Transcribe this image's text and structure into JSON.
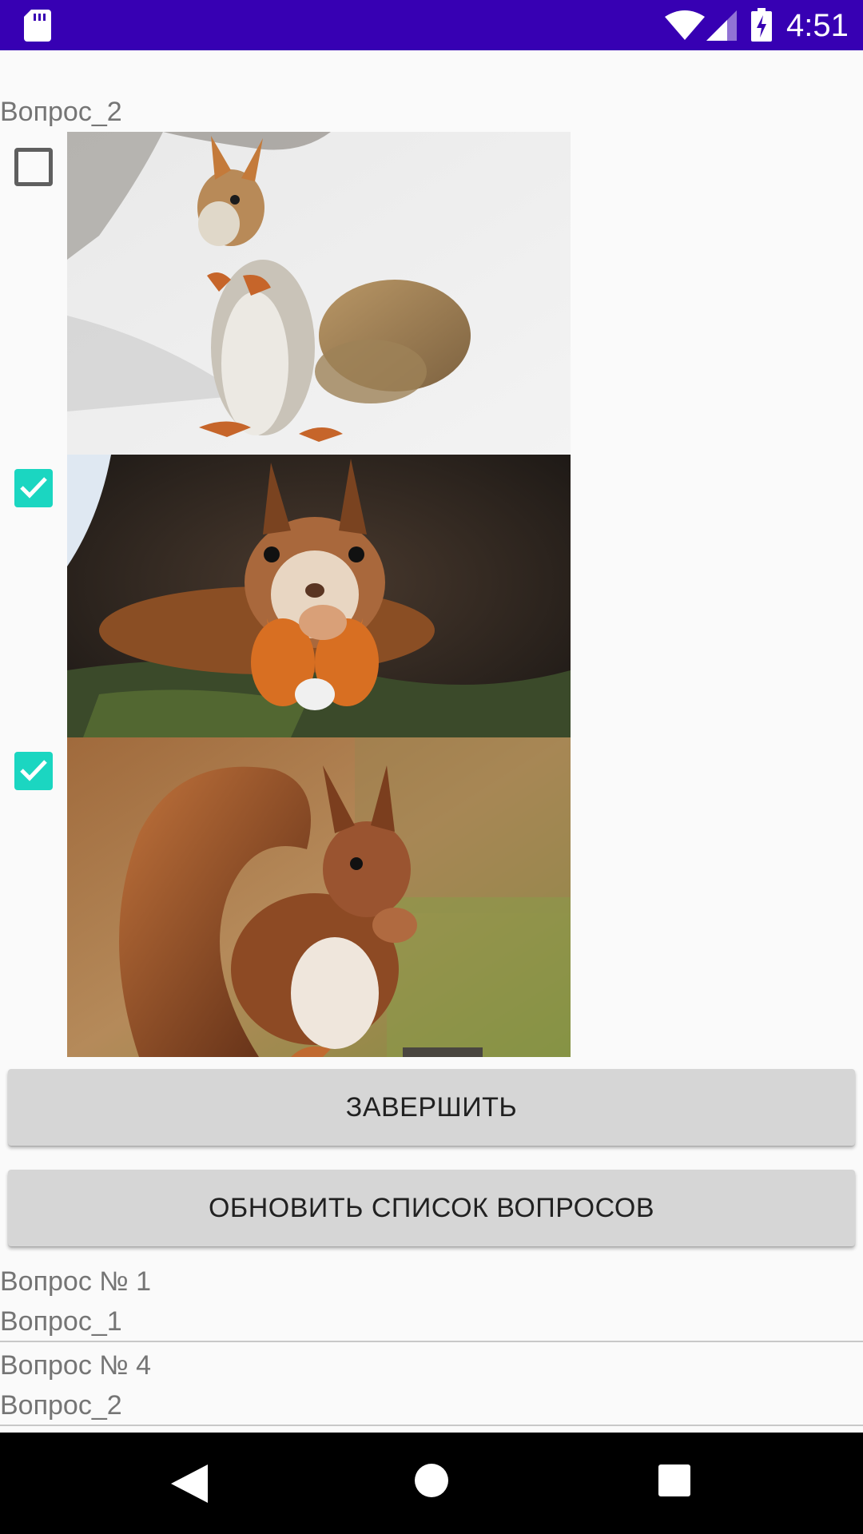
{
  "status_bar": {
    "time": "4:51",
    "icons": [
      "sd-card-icon",
      "wifi-icon",
      "cell-signal-icon",
      "battery-charging-icon"
    ],
    "background_color": "#3700b3"
  },
  "question": {
    "title": "Вопрос_2",
    "options": [
      {
        "image": "squirrel standing on snow",
        "checked": false
      },
      {
        "image": "squirrel lying on mossy log",
        "checked": true
      },
      {
        "image": "red squirrel eating",
        "checked": true
      }
    ],
    "checkbox_color": "#1bd6c1"
  },
  "buttons": {
    "finish_label": "ЗАВЕРШИТЬ",
    "refresh_label": "ОБНОВИТЬ СПИСОК ВОПРОСОВ"
  },
  "question_list": [
    {
      "number": "Вопрос № 1",
      "name": "Вопрос_1"
    },
    {
      "number": "Вопрос № 4",
      "name": "Вопрос_2"
    }
  ],
  "nav_bar": {
    "icons": [
      "back-icon",
      "home-icon",
      "recents-icon"
    ]
  }
}
